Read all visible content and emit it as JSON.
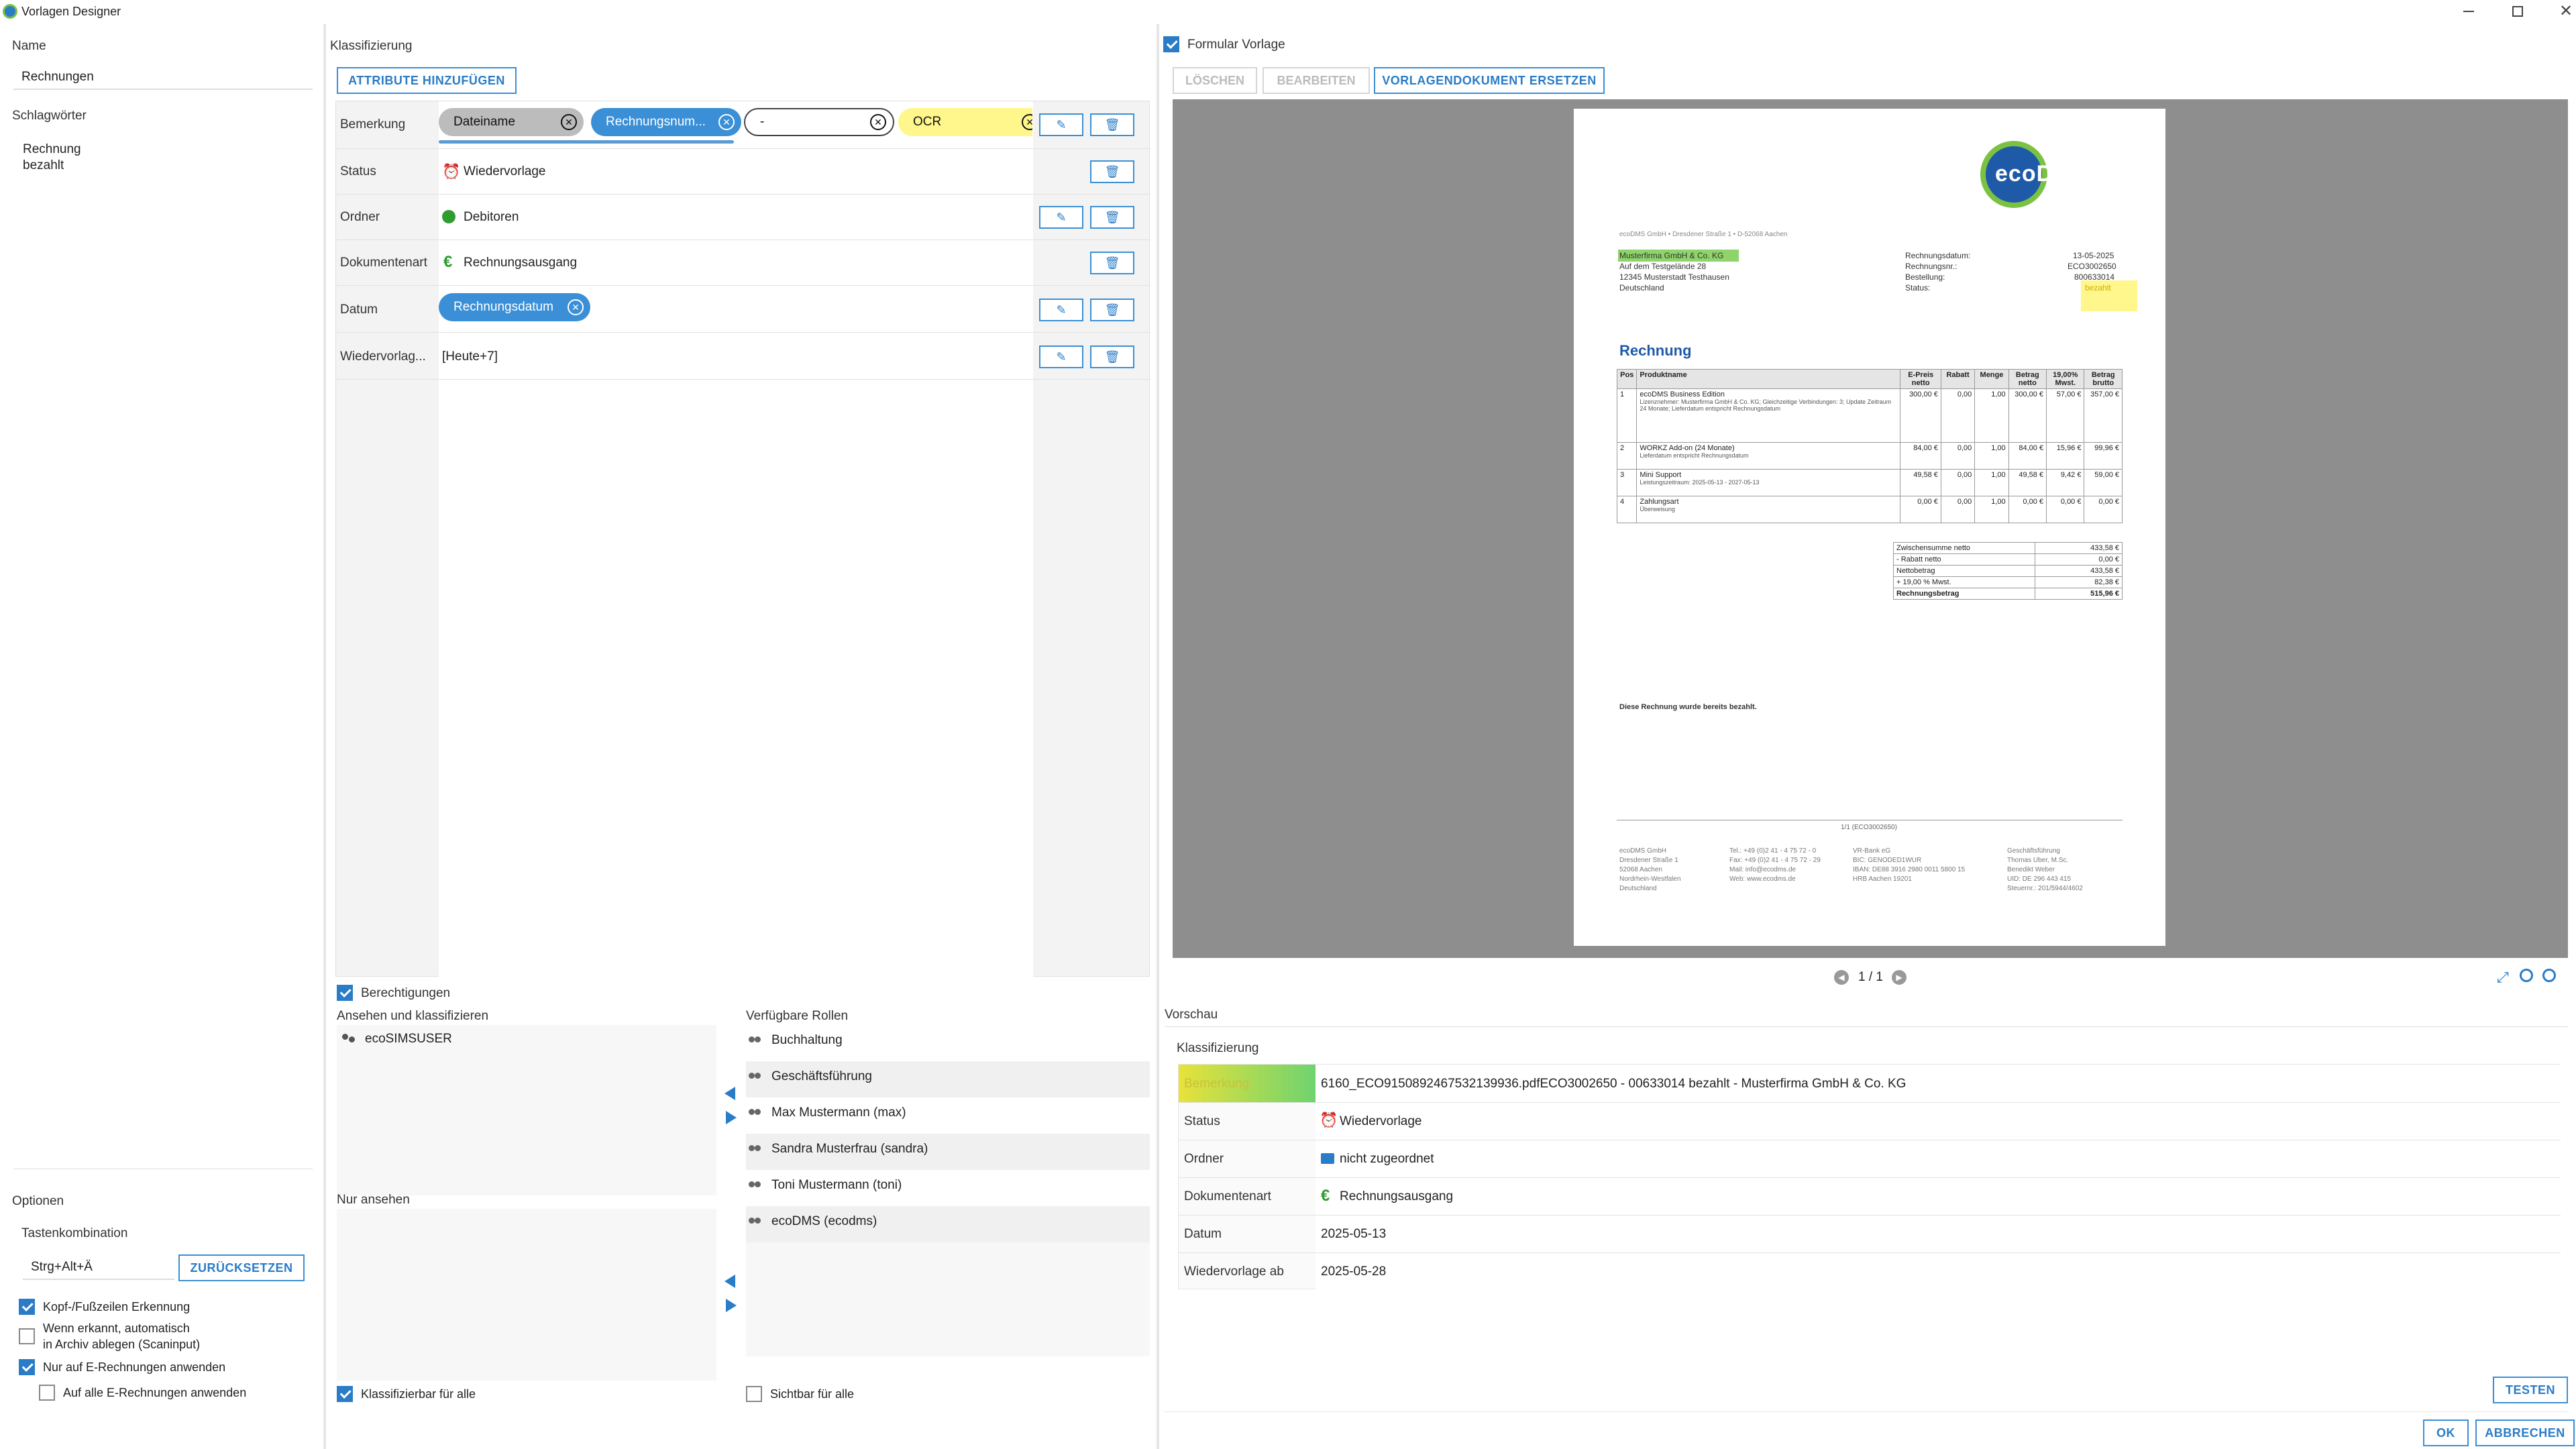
{
  "window": {
    "title": "Vorlagen Designer"
  },
  "left": {
    "name_label": "Name",
    "name_value": "Rechnungen",
    "keywords_label": "Schlagwörter",
    "keywords": [
      "Rechnung",
      "bezahlt"
    ],
    "options_label": "Optionen",
    "shortcut_label": "Tastenkombination",
    "shortcut_value": "Strg+Alt+Ä",
    "reset_button": "ZURÜCKSETZEN",
    "opt1": "Kopf-/Fußzeilen Erkennung",
    "opt2_line1": "Wenn erkannt, automatisch",
    "opt2_line2": "in Archiv ablegen (Scaninput)",
    "opt3": "Nur auf E-Rechnungen anwenden",
    "opt4": "Auf alle E-Rechnungen anwenden"
  },
  "classification": {
    "title": "Klassifizierung",
    "add_button": "ATTRIBUTE HINZUFÜGEN",
    "rows": {
      "bemerkung": {
        "label": "Bemerkung",
        "chips": [
          "Dateiname",
          "Rechnungsnum...",
          "-",
          "OCR"
        ]
      },
      "status": {
        "label": "Status",
        "value": "Wiedervorlage"
      },
      "ordner": {
        "label": "Ordner",
        "value": "Debitoren"
      },
      "dokumentenart": {
        "label": "Dokumentenart",
        "value": "Rechnungsausgang"
      },
      "datum": {
        "label": "Datum",
        "chip": "Rechnungsdatum"
      },
      "wiedervorlage": {
        "label": "Wiedervorlag...",
        "value": "[Heute+7]"
      }
    }
  },
  "permissions": {
    "title": "Berechtigungen",
    "view_classify_label": "Ansehen und klassifizieren",
    "view_classify_items": [
      "ecoSIMSUSER"
    ],
    "available_roles_label": "Verfügbare Rollen",
    "roles": [
      "Buchhaltung",
      "Geschäftsführung",
      "Max Mustermann (max)",
      "Sandra Musterfrau (sandra)",
      "Toni Mustermann (toni)",
      "ecoDMS (ecodms)"
    ],
    "view_only_label": "Nur ansehen",
    "classifiable_all": "Klassifizierbar für alle",
    "visible_all": "Sichtbar für alle"
  },
  "form_template": {
    "checkbox_label": "Formular Vorlage",
    "delete_button": "LÖSCHEN",
    "edit_button": "BEARBEITEN",
    "replace_button": "VORLAGENDOKUMENT ERSETZEN",
    "pager": "1 / 1"
  },
  "invoice": {
    "logo": "ecoDMS",
    "sender_line": "ecoDMS GmbH • Dresdener Straße 1 • D-52068 Aachen",
    "address": [
      "Musterfirma GmbH & Co. KG",
      "Auf dem Testgelände 28",
      "12345 Musterstadt Testhausen",
      "Deutschland"
    ],
    "meta_labels": [
      "Rechnungsdatum:",
      "Rechnungsnr.:",
      "Bestellung:",
      "Status:"
    ],
    "meta_values": [
      "13-05-2025",
      "ECO3002650",
      "800633014",
      "bezahlt"
    ],
    "heading": "Rechnung",
    "table_headers": [
      "Pos",
      "Produktname",
      "E-Preis netto",
      "Rabatt",
      "Menge",
      "Betrag netto",
      "19,00% Mwst.",
      "Betrag brutto"
    ],
    "items": [
      {
        "pos": "1",
        "name": "ecoDMS Business Edition",
        "sub": "Lizenznehmer: Musterfirma GmbH & Co. KG; Gleichzeitige Verbindungen: 3; Update Zeitraum 24 Monate; Lieferdatum entspricht Rechnungsdatum",
        "ep": "300,00 €",
        "rab": "0,00",
        "menge": "1,00",
        "bn": "300,00 €",
        "mwst": "57,00 €",
        "bb": "357,00 €"
      },
      {
        "pos": "2",
        "name": "WORKZ Add-on (24 Monate)",
        "sub": "Lieferdatum entspricht Rechnungsdatum",
        "ep": "84,00 €",
        "rab": "0,00",
        "menge": "1,00",
        "bn": "84,00 €",
        "mwst": "15,96 €",
        "bb": "99,96 €"
      },
      {
        "pos": "3",
        "name": "Mini Support",
        "sub": "Leistungszeitraum: 2025-05-13 - 2027-05-13",
        "ep": "49,58 €",
        "rab": "0,00",
        "menge": "1,00",
        "bn": "49,58 €",
        "mwst": "9,42 €",
        "bb": "59,00 €"
      },
      {
        "pos": "4",
        "name": "Zahlungsart",
        "sub": "Überweisung",
        "ep": "0,00 €",
        "rab": "0,00",
        "menge": "1,00",
        "bn": "0,00 €",
        "mwst": "0,00 €",
        "bb": "0,00 €"
      }
    ],
    "totals": [
      {
        "label": "Zwischensumme netto",
        "value": "433,58 €"
      },
      {
        "label": "- Rabatt netto",
        "value": "0,00 €"
      },
      {
        "label": "Nettobetrag",
        "value": "433,58 €"
      },
      {
        "label": "+ 19,00 % Mwst.",
        "value": "82,38 €"
      },
      {
        "label": "Rechnungsbetrag",
        "value": "515,96 €"
      }
    ],
    "paid_note": "Diese Rechnung wurde bereits bezahlt.",
    "page_num": "1/1 (ECO3002650)",
    "footer_col1": [
      "ecoDMS GmbH",
      "Dresdener Straße 1",
      "52068 Aachen",
      "Nordrhein-Westfalen",
      "Deutschland"
    ],
    "footer_col2": [
      "Tel.: +49 (0)2 41 - 4 75 72 - 0",
      "Fax: +49 (0)2 41 - 4 75 72 - 29",
      "Mail: info@ecodms.de",
      "Web: www.ecodms.de"
    ],
    "footer_col3": [
      "VR-Bank eG",
      "BIC: GENODED1WUR",
      "IBAN: DE88 3916 2980 0011 5800 15",
      "HRB Aachen 19201"
    ],
    "footer_col4": [
      "Geschäftsführung",
      "Thomas Uber, M.Sc.",
      "Benedikt Weber",
      "UID: DE 296 443 415",
      "Steuernr.: 201/5944/4602"
    ]
  },
  "preview": {
    "title": "Vorschau",
    "subtitle": "Klassifizierung",
    "rows": [
      {
        "label": "Bemerkung",
        "value": "6160_ECO9150892467532139936.pdfECO3002650 - 00633014 bezahlt - Musterfirma GmbH & Co. KG"
      },
      {
        "label": "Status",
        "value": "Wiedervorlage"
      },
      {
        "label": "Ordner",
        "value": "nicht zugeordnet"
      },
      {
        "label": "Dokumentenart",
        "value": "Rechnungsausgang"
      },
      {
        "label": "Datum",
        "value": "2025-05-13"
      },
      {
        "label": "Wiedervorlage ab",
        "value": "2025-05-28"
      }
    ],
    "test_button": "TESTEN"
  },
  "dialog": {
    "ok_button": "OK",
    "cancel_button": "ABBRECHEN"
  },
  "colors": {
    "accent": "#2a7cc7",
    "chip_gray": "#bcbcbc",
    "chip_blue": "#3a8fd6",
    "chip_yellow": "#fff68c",
    "preview_bg": "#8e8e8e",
    "status_orange": "#f08a24",
    "folder_green": "#2f9c2f"
  }
}
